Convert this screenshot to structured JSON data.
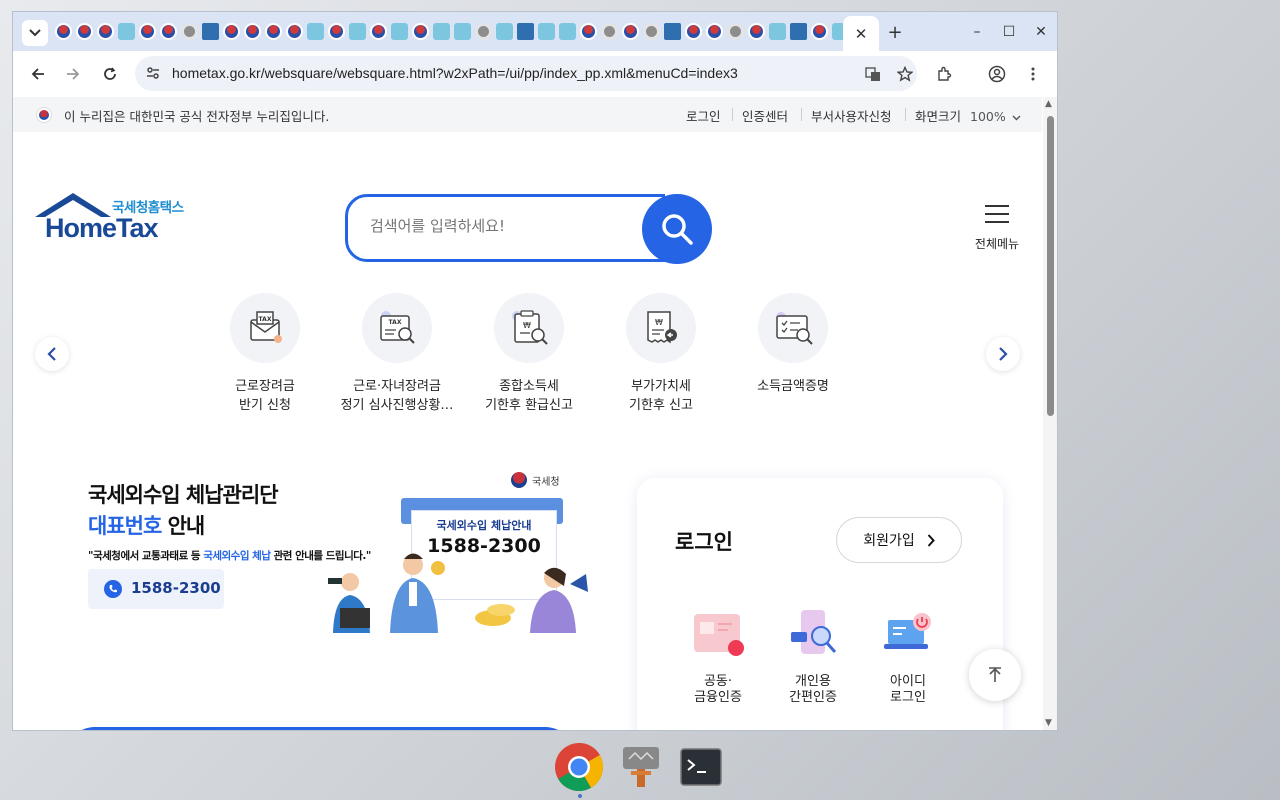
{
  "browser": {
    "url": "hometax.go.kr/websquare/websquare.html?w2xPath=/ui/pp/index_pp.xml&menuCd=index3",
    "active_tab_close": "✕",
    "new_tab": "+",
    "window_controls": {
      "minimize": "–",
      "maximize": "☐",
      "close": "✕"
    }
  },
  "gov_banner": {
    "text": "이 누리집은 대한민국 공식 전자정부 누리집입니다.",
    "links": [
      "로그인",
      "인증센터",
      "부서사용자신청"
    ],
    "zoom_label": "화면크기",
    "zoom_value": "100%"
  },
  "header": {
    "logo_sub": "국세청홈택스",
    "logo_main": "HomeTax",
    "search_placeholder": "검색어를 입력하세요!",
    "menu_label": "전체메뉴"
  },
  "quick_menu": [
    {
      "line1": "근로장려금",
      "line2": "반기 신청",
      "icon": "tax-envelope-icon"
    },
    {
      "line1": "근로·자녀장려금",
      "line2": "정기 심사진행상황…",
      "icon": "tax-search-icon"
    },
    {
      "line1": "종합소득세",
      "line2": "기한후 환급신고",
      "icon": "receipt-search-icon"
    },
    {
      "line1": "부가가치세",
      "line2": "기한후 신고",
      "icon": "invoice-icon"
    },
    {
      "line1": "소득금액증명",
      "line2": "",
      "icon": "certificate-search-icon"
    }
  ],
  "promo": {
    "title1": "국세외수입 체납관리단",
    "title2_blue": "대표번호",
    "title2_rest": " 안내",
    "desc_pre": "\"국세청에서 교통과태료 등 ",
    "desc_blue": "국세외수입 체납",
    "desc_post": " 관련 안내를 드립니다.\"",
    "phone": "1588-2300",
    "badge": "국세청",
    "card_title": "국세외수입 체납안내",
    "card_number": "1588-2300"
  },
  "login": {
    "title": "로그인",
    "join_label": "회원가입",
    "options": [
      {
        "line1": "공동·",
        "line2": "금융인증"
      },
      {
        "line1": "개인용",
        "line2": "간편인증"
      },
      {
        "line1": "아이디",
        "line2": "로그인"
      }
    ]
  },
  "colors": {
    "brand_blue": "#2564e5",
    "logo_navy": "#1a4a97",
    "logo_sky": "#1d8cd1"
  }
}
